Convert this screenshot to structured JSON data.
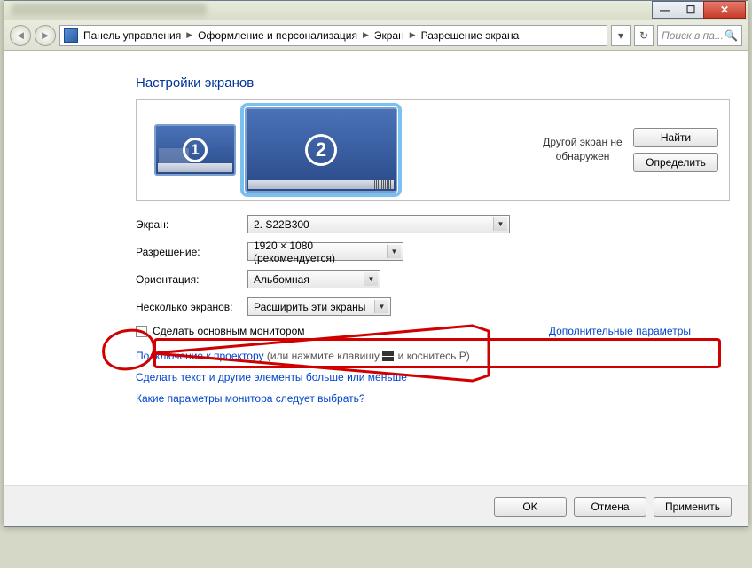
{
  "titlebar": {
    "min_tip": "Свернуть",
    "max_tip": "Развернуть",
    "close_tip": "Закрыть"
  },
  "breadcrumbs": {
    "parts": [
      "Панель управления",
      "Оформление и персонализация",
      "Экран",
      "Разрешение экрана"
    ],
    "search_placeholder": "Поиск в па..."
  },
  "page": {
    "heading": "Настройки экранов",
    "monitor1_num": "1",
    "monitor2_num": "2",
    "other_not_found": "Другой экран не обнаружен",
    "find_btn": "Найти",
    "identify_btn": "Определить"
  },
  "form": {
    "screen_label": "Экран:",
    "screen_value": "2. S22B300",
    "res_label": "Разрешение:",
    "res_value": "1920 × 1080 (рекомендуется)",
    "orient_label": "Ориентация:",
    "orient_value": "Альбомная",
    "multi_label": "Несколько экранов:",
    "multi_value": "Расширить эти экраны",
    "make_primary": "Сделать основным монитором",
    "advanced": "Дополнительные параметры"
  },
  "links": {
    "projector_link": "Подключение к проектору",
    "projector_hint_a": " (или нажмите клавишу ",
    "projector_hint_b": " и коснитесь P)",
    "textsize": "Сделать текст и другие элементы больше или меньше",
    "whichsettings": "Какие параметры монитора следует выбрать?"
  },
  "footer": {
    "ok": "OK",
    "cancel": "Отмена",
    "apply": "Применить"
  }
}
